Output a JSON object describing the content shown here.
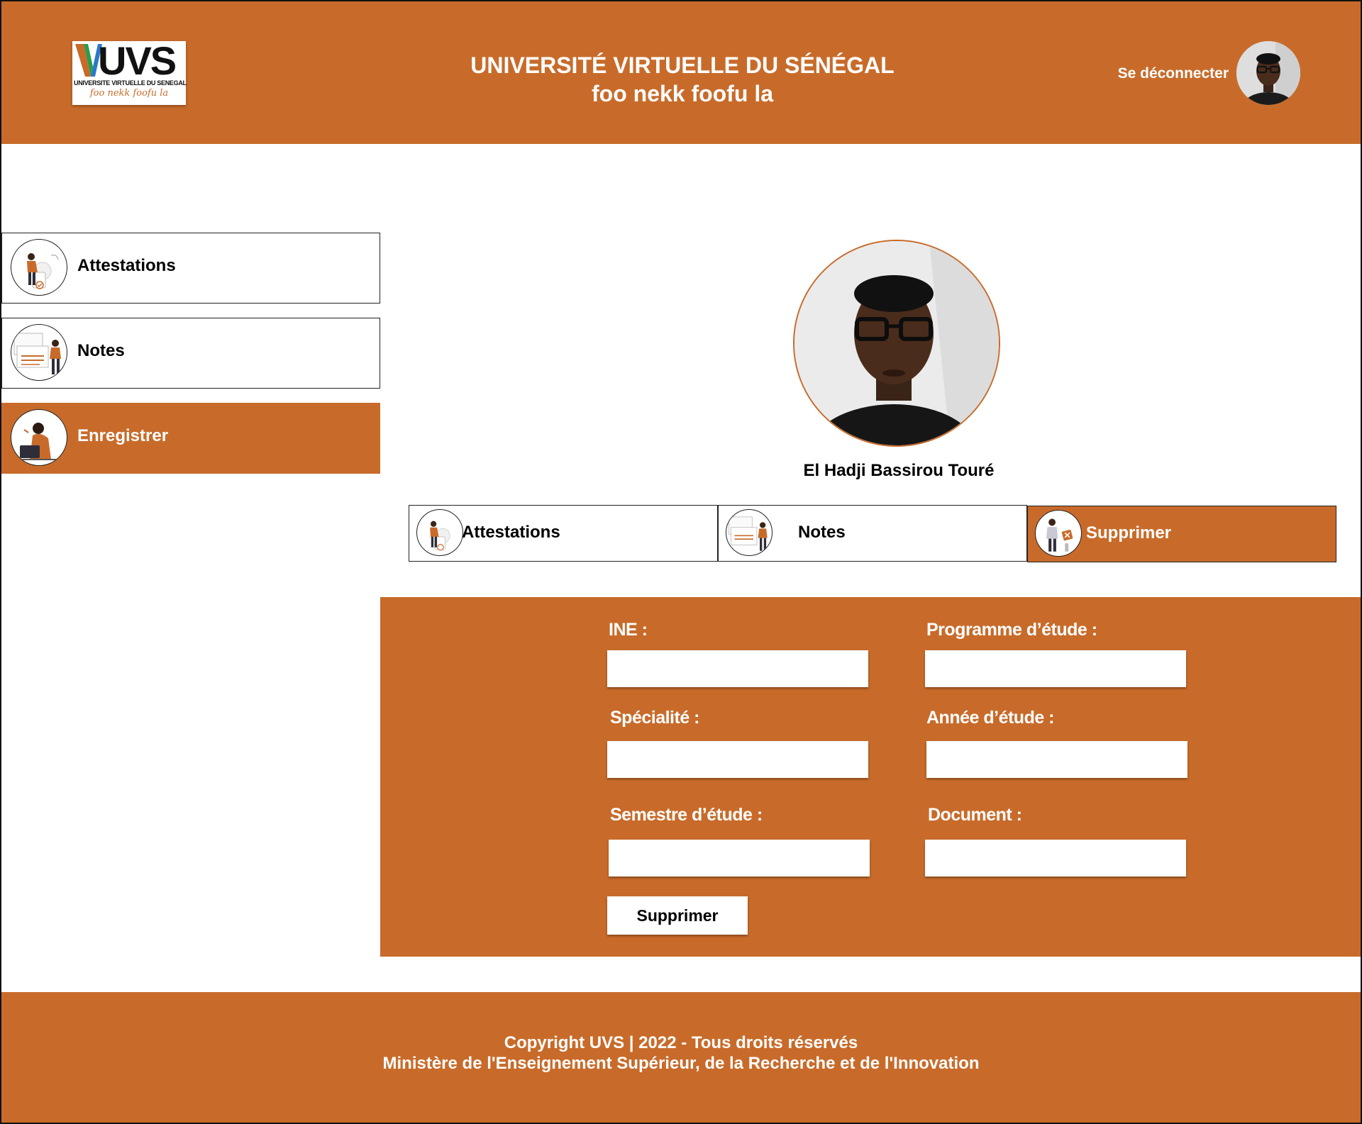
{
  "header": {
    "logo_text": "UVS",
    "logo_fullname": "UNIVERSITE VIRTUELLE DU SENEGAL",
    "logo_motto": "foo nekk foofu la",
    "title": "UNIVERSITÉ VIRTUELLE DU SÉNÉGAL",
    "subtitle": "foo nekk foofu la",
    "logout_label": "Se déconnecter"
  },
  "sidebar": {
    "items": [
      {
        "label": "Attestations",
        "icon": "attestation-illustration-icon",
        "active": false
      },
      {
        "label": "Notes",
        "icon": "notes-illustration-icon",
        "active": false
      },
      {
        "label": "Enregistrer",
        "icon": "register-illustration-icon",
        "active": true
      }
    ]
  },
  "profile": {
    "name": "El Hadji Bassirou Touré"
  },
  "tabs": [
    {
      "label": "Attestations",
      "icon": "attestation-illustration-icon",
      "active": false
    },
    {
      "label": "Notes",
      "icon": "notes-illustration-icon",
      "active": false
    },
    {
      "label": "Supprimer",
      "icon": "delete-illustration-icon",
      "active": true
    }
  ],
  "form": {
    "ine_label": "INE :",
    "ine_value": "",
    "programme_label": "Programme d’étude :",
    "programme_value": "",
    "specialite_label": "Spécialité :",
    "specialite_value": "",
    "annee_label": "Année d’étude :",
    "annee_value": "",
    "semestre_label": "Semestre d’étude :",
    "semestre_value": "",
    "document_label": "Document :",
    "document_value": "",
    "submit_label": "Supprimer"
  },
  "footer": {
    "line1": "Copyright UVS | 2022 - Tous droits réservés",
    "line2": "Ministère de l'Enseignement Supérieur, de la Recherche et de l'Innovation"
  },
  "colors": {
    "brand": "#c86b2a",
    "text": "#000000",
    "on_brand": "#ffffff"
  }
}
